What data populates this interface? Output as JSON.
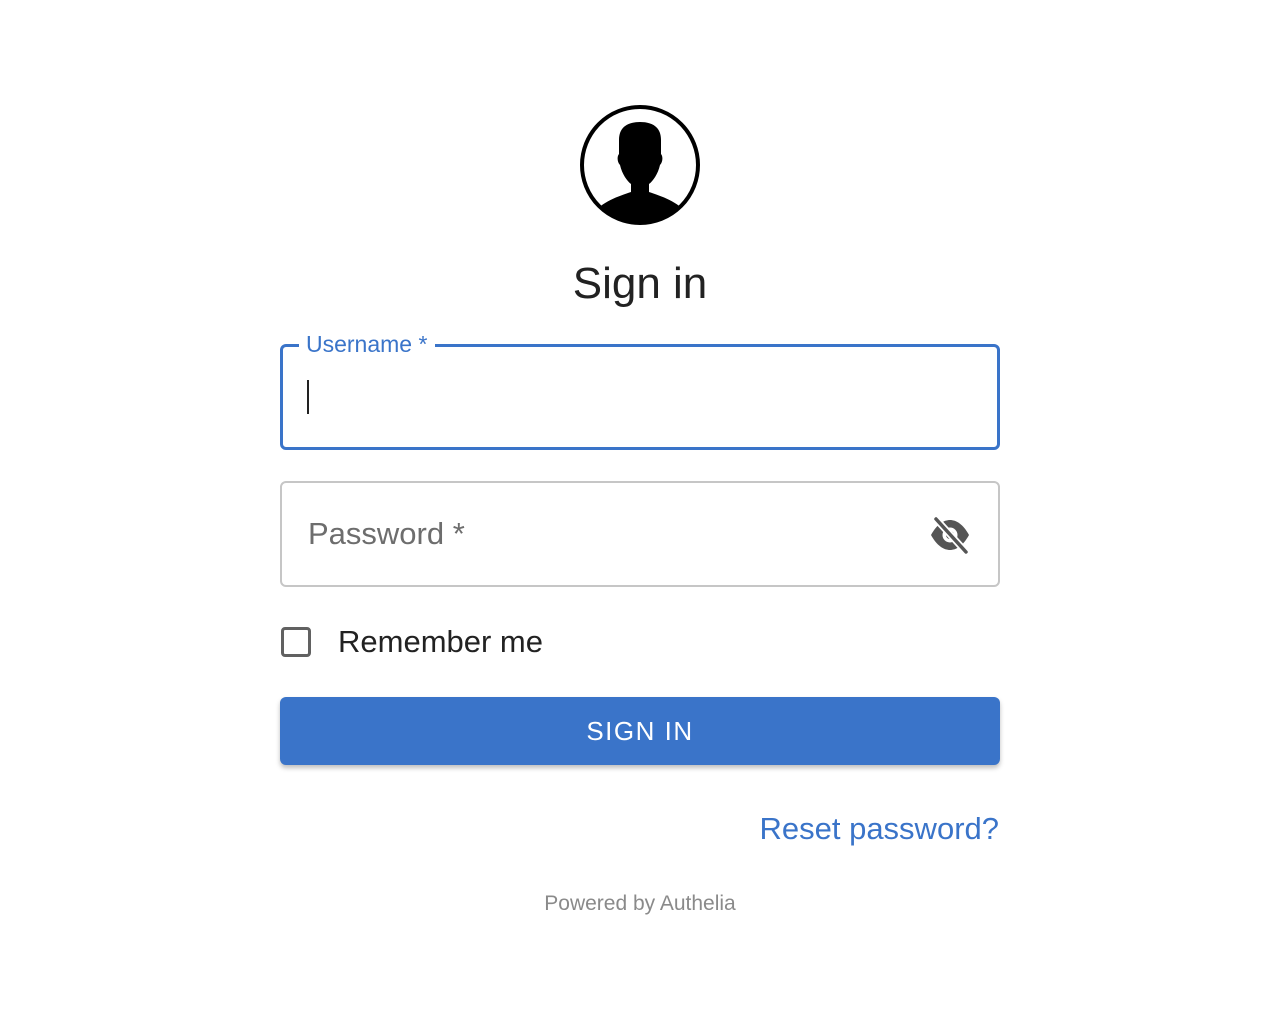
{
  "page": {
    "title": "Sign in",
    "avatar_icon": "user-silhouette-icon"
  },
  "username_field": {
    "label": "Username *",
    "value": "",
    "focused": true
  },
  "password_field": {
    "placeholder": "Password *",
    "value": "",
    "visibility_icon": "eye-off-icon"
  },
  "remember_me": {
    "label": "Remember me",
    "checked": false
  },
  "sign_in_button": {
    "label": "SIGN IN"
  },
  "reset_link": {
    "label": "Reset password?"
  },
  "footer": {
    "text": "Powered by Authelia"
  },
  "colors": {
    "primary": "#3a74c9",
    "text": "#222222",
    "muted": "#8a8a8a",
    "border": "#c6c6c6"
  }
}
